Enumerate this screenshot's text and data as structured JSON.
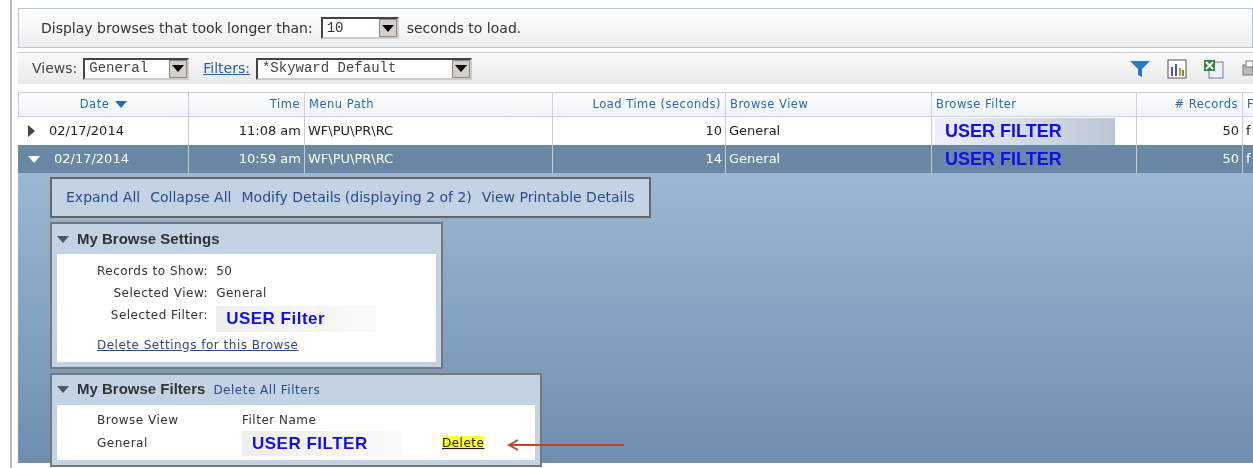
{
  "threshold_bar": {
    "label": "Display browses that took longer than:",
    "value": "10",
    "suffix": "seconds to load."
  },
  "toolbar": {
    "views_label": "Views:",
    "view_value": "General",
    "filters_link": "Filters:",
    "filter_value": "*Skyward Default"
  },
  "table": {
    "columns": [
      "Date",
      "Time",
      "Menu Path",
      "Load Time (seconds)",
      "Browse View",
      "Browse Filter",
      "# Records",
      "F"
    ],
    "rows": [
      {
        "expanded": false,
        "selected": false,
        "cells": [
          "02/17/2014",
          "11:08 am",
          "WF\\PU\\PR\\RC",
          "10",
          "General",
          "USER FILTER",
          "50",
          "f"
        ]
      },
      {
        "expanded": true,
        "selected": true,
        "cells": [
          "02/17/2014",
          "10:59 am",
          "WF\\PU\\PR\\RC",
          "14",
          "General",
          "USER FILTER",
          "50",
          "f"
        ]
      }
    ]
  },
  "details": {
    "links": [
      "Expand All",
      "Collapse All",
      "Modify Details"
    ],
    "displaying": "(displaying 2 of 2)",
    "printable_link": "View Printable Details",
    "settings": {
      "title": "My Browse Settings",
      "expanded": true,
      "fields": [
        {
          "label": "Records to Show:",
          "value": "50"
        },
        {
          "label": "Selected View:",
          "value": "General"
        },
        {
          "label": "Selected Filter:",
          "value": "USER Filter"
        }
      ],
      "delete_link": "Delete Settings for this Browse"
    },
    "filters": {
      "title": "My Browse Filters",
      "expanded": true,
      "delete_all_link": "Delete All Filters",
      "columns": [
        "Browse View",
        "Filter Name"
      ],
      "rows": [
        {
          "view": "General",
          "filter": "USER FILTER",
          "delete": "Delete"
        }
      ]
    }
  }
}
